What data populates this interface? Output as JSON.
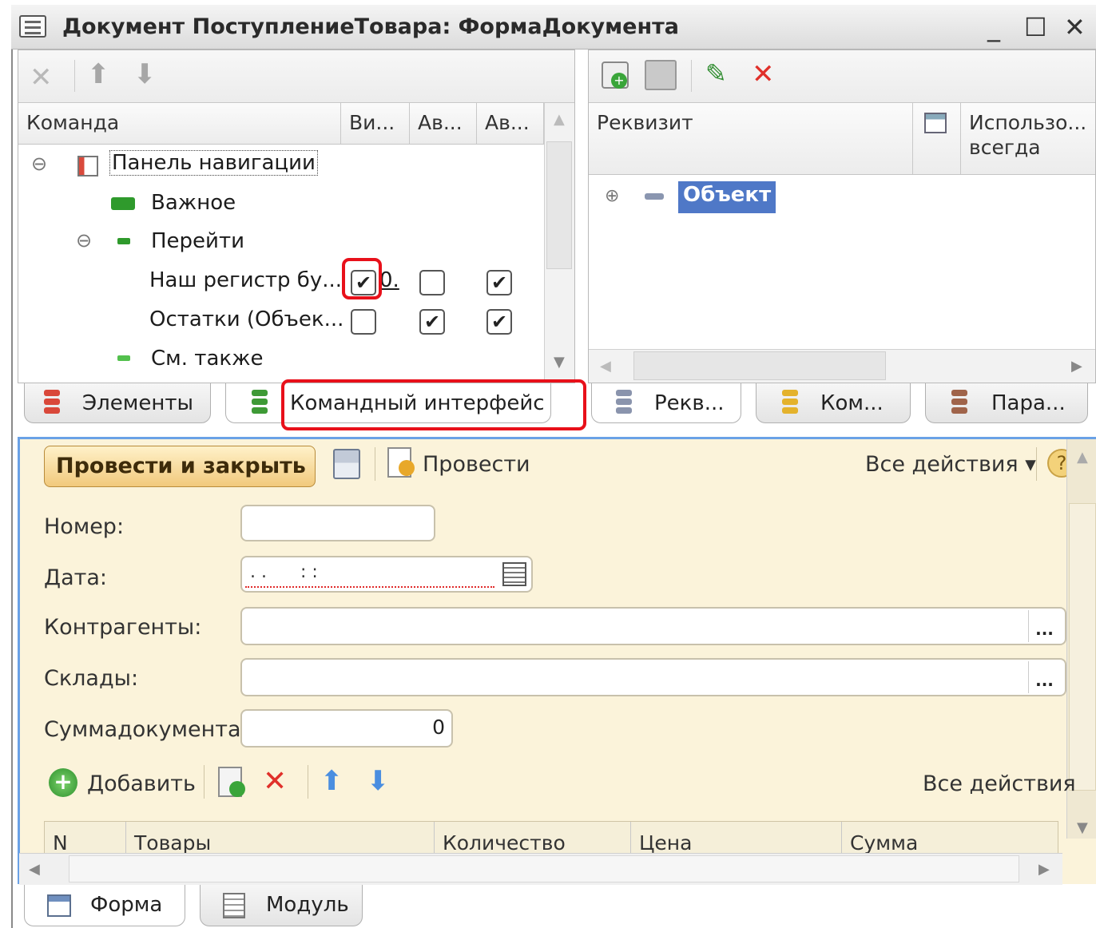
{
  "window": {
    "title": "Документ ПоступлениеТовара: ФормаДокумента",
    "minimize": "_",
    "maximize": "☐",
    "close": "✕"
  },
  "commands": {
    "headers": [
      "Команда",
      "Ви...",
      "Ав...",
      "Ав..."
    ],
    "tree": [
      {
        "label": "Панель навигации",
        "expander": "⊖"
      },
      {
        "label": "Важное"
      },
      {
        "label": "Перейти",
        "expander": "⊖"
      },
      {
        "label": "Наш регистр бу...",
        "vis": true,
        "extra": "0.",
        "a1": false,
        "a2": true
      },
      {
        "label": "Остатки (Объек...",
        "vis": false,
        "a1": true,
        "a2": true
      },
      {
        "label": "См. также"
      }
    ]
  },
  "props": {
    "header_rekvizit": "Реквизит",
    "header_use_line1": "Использо...",
    "header_use_line2": "всегда",
    "item": "Объект",
    "expander": "⊕"
  },
  "tabs_left": [
    "Элементы",
    "Командный интерфейс"
  ],
  "tabs_right": [
    "Рекв...",
    "Ком...",
    "Пара..."
  ],
  "form": {
    "btn_post_close": "Провести и закрыть",
    "btn_post": "Провести",
    "all_actions": "Все действия ▾",
    "help": "?",
    "fields": {
      "number_label": "Номер:",
      "date_label": "Дата:",
      "date_mask": ". .      : :",
      "contractors_label": "Контрагенты:",
      "warehouses_label": "Склады:",
      "sum_label": "Суммадокумента:",
      "sum_value": "0",
      "select_btn": "..."
    },
    "table_toolbar": {
      "add": "Добавить",
      "all_actions": "Все действия"
    },
    "table_headers": [
      "N",
      "Товары",
      "Количество",
      "Цена",
      "Сумма"
    ]
  },
  "bottom_tabs": [
    "Форма",
    "Модуль"
  ],
  "colors": {
    "highlight": "#e8101a",
    "selection": "#4f78c7",
    "form_bg": "#fbf3da"
  }
}
